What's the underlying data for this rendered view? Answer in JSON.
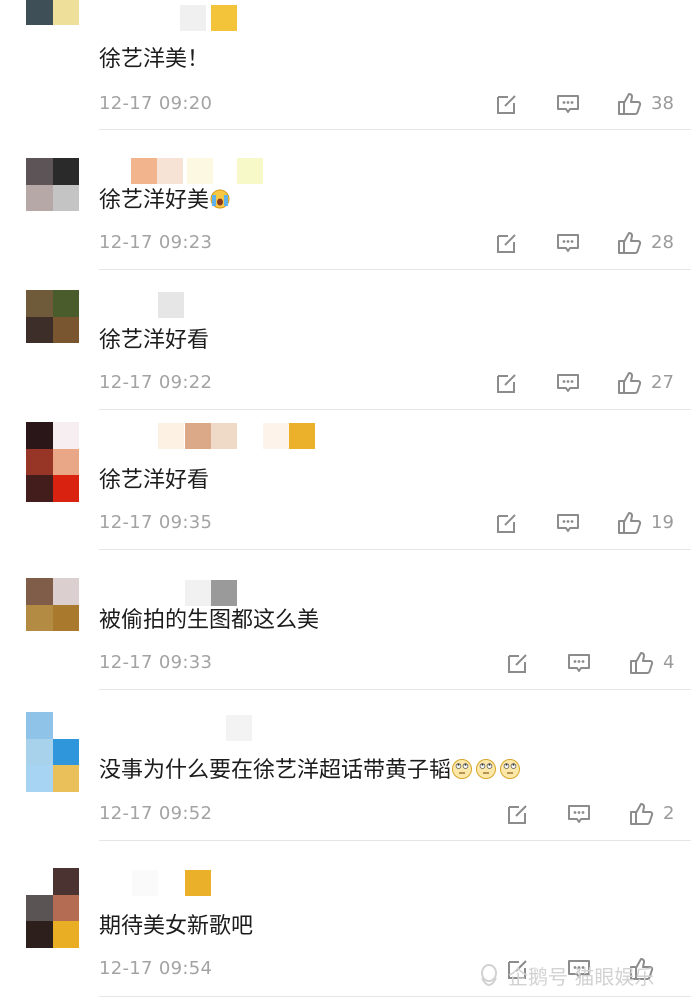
{
  "comments": [
    {
      "text": "徐艺洋美！",
      "time": "12-17 09:20",
      "likes": "38",
      "avatar": [
        "#8fa9c6",
        "#c6d2dd",
        "#3f4f58",
        "#eedf9a"
      ],
      "name_blocks": [
        "#ffffff",
        "#f0f0f0",
        "#f3c33a"
      ]
    },
    {
      "text": "徐艺洋好美",
      "time": "12-17 09:23",
      "likes": "28",
      "emoji": "crying-face-emoji",
      "avatar": [
        "#5c5457",
        "#2a2a2a",
        "#b7a8a8",
        "#c4c4c4"
      ],
      "name_blocks": [
        "#f1b48d",
        "#f6e3d6",
        "#fdf8e1",
        "#f7f9c8"
      ]
    },
    {
      "text": "徐艺洋好看",
      "time": "12-17 09:22",
      "likes": "27",
      "avatar": [
        "#6f5a3a",
        "#4a5b2c",
        "#3e2e2a",
        "#7a5630"
      ],
      "name_blocks": [
        "#ffffff",
        "#e6e6e6"
      ]
    },
    {
      "text": "徐艺洋好看",
      "time": "12-17 09:35",
      "likes": "19",
      "avatar": [
        "#2a1519",
        "#f6eef0",
        "#973626",
        "#e9a788",
        "#431c1c",
        "#d9220f"
      ],
      "name_blocks": [
        "#fdf1e3",
        "#dba888",
        "#efdac8",
        "#fdf3ea",
        "#ebb12a"
      ]
    },
    {
      "text": "被偷拍的生图都这么美",
      "time": "12-17 09:33",
      "likes": "4",
      "avatar": [
        "#7f5d48",
        "#dbd0cf",
        "#b48b42",
        "#a97a2d"
      ],
      "name_blocks": [
        "#f1f1f1",
        "#9a9a9a"
      ]
    },
    {
      "text": "没事为什么要在徐艺洋超话带黄子韬",
      "time": "12-17 09:52",
      "likes": "2",
      "emoji": "eye-roll-emoji",
      "avatar": [
        "#8fc3e8",
        "#ffffff",
        "#a8d2ec",
        "#2f96dc",
        "#a6d4f2",
        "#eac05b"
      ],
      "name_blocks": [
        "#ffffff",
        "#f3f3f3"
      ]
    },
    {
      "text": "期待美女新歌吧",
      "time": "12-17 09:54",
      "likes": "",
      "avatar": [
        "#ffffff",
        "#4a3330",
        "#5a5554",
        "#b46c52",
        "#2c1f1c",
        "#eaae25"
      ],
      "name_blocks": [
        "#fafafa",
        "#eab02a"
      ]
    }
  ],
  "watermark": {
    "text": "企鹅号 猫眼娱乐",
    "icon": "penguin-icon"
  }
}
